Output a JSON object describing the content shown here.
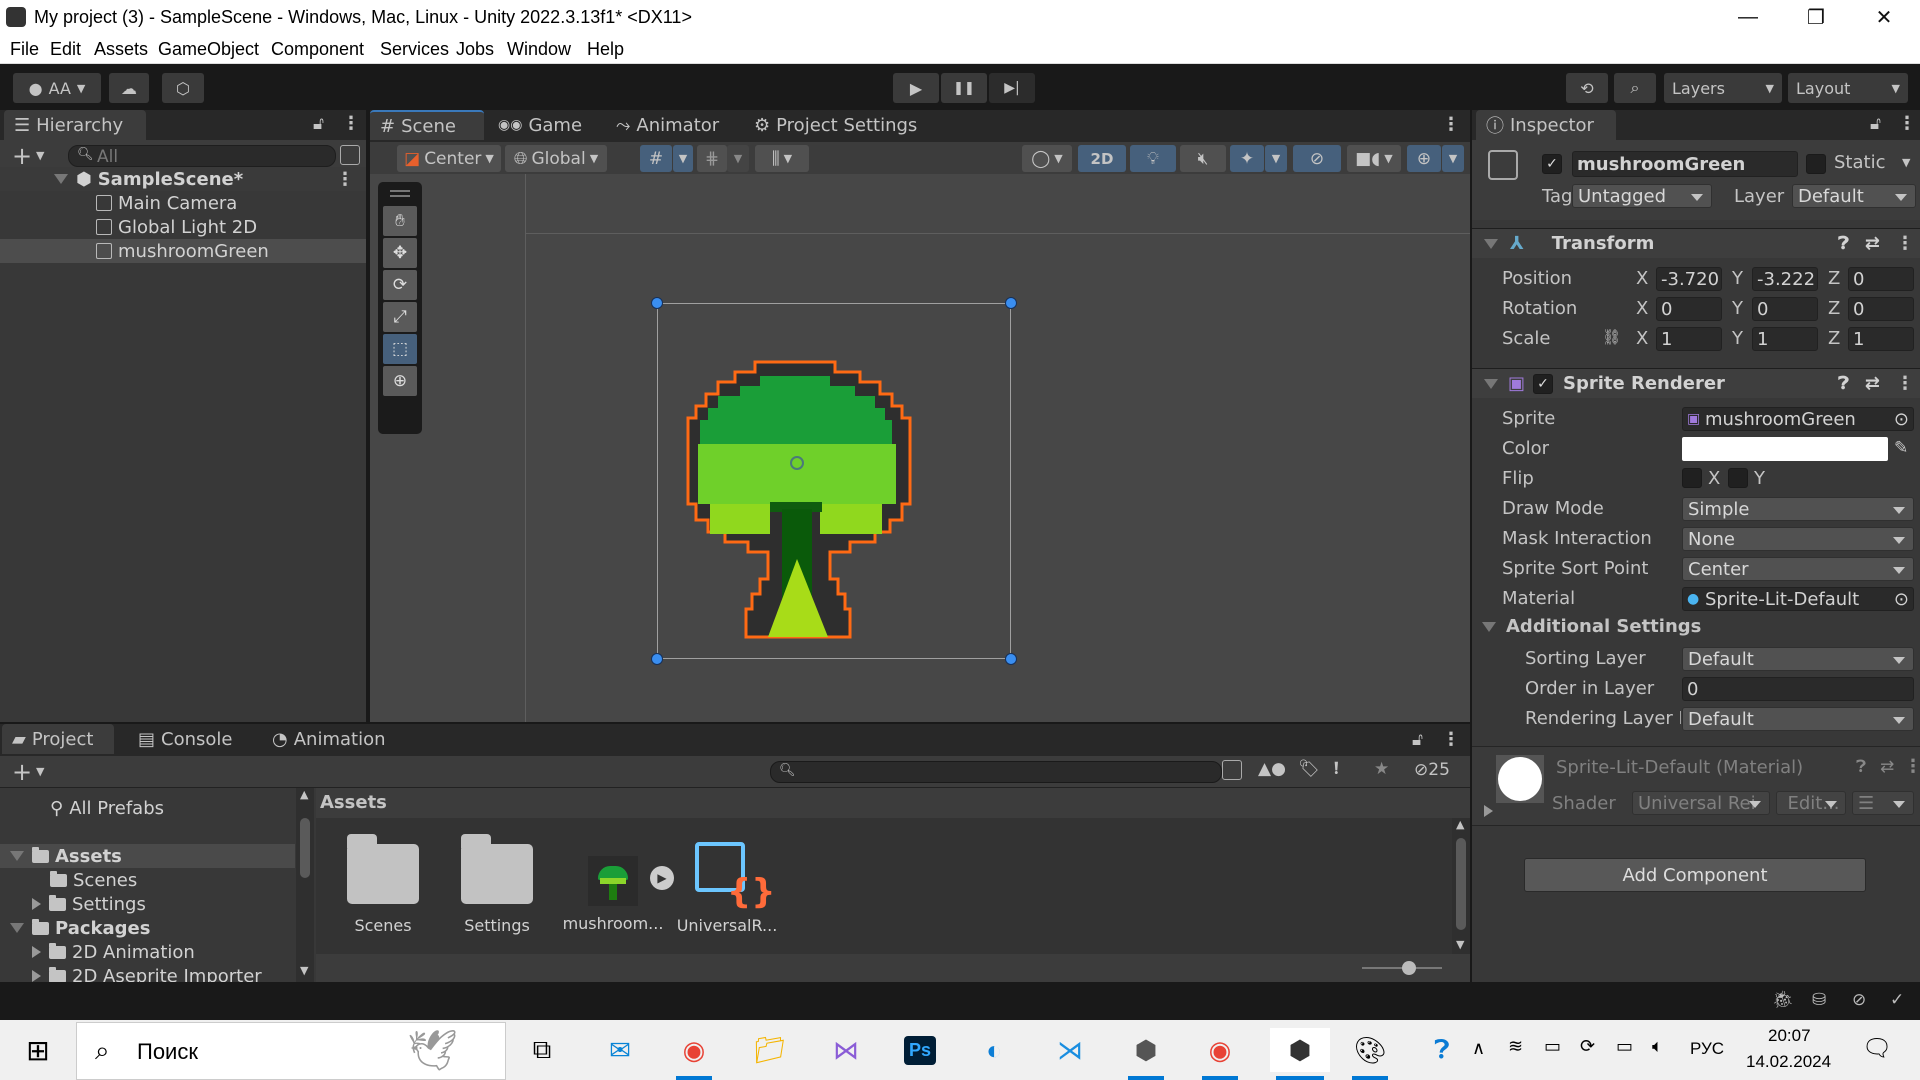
{
  "window": {
    "title": "My project (3) - SampleScene - Windows, Mac, Linux - Unity 2022.3.13f1* <DX11>",
    "controls": {
      "minimize": "—",
      "maximize": "❐",
      "close": "✕"
    }
  },
  "menu": [
    "File",
    "Edit",
    "Assets",
    "GameObject",
    "Component",
    "Services",
    "Jobs",
    "Window",
    "Help"
  ],
  "toolbar": {
    "account_label": "AA",
    "play_icon": "▶",
    "pause_icon": "❚❚",
    "step_icon": "▶|",
    "history_icon": "⟲",
    "search_icon": "⌕",
    "layers_label": "Layers",
    "layout_label": "Layout"
  },
  "hierarchy": {
    "tab_label": "Hierarchy",
    "search_placeholder": "All",
    "add_label": "+",
    "scene_name": "SampleScene*",
    "items": [
      "Main Camera",
      "Global Light 2D",
      "mushroomGreen"
    ],
    "selected": "mushroomGreen"
  },
  "center_tabs": [
    {
      "label": "Scene",
      "icon": "#"
    },
    {
      "label": "Game",
      "icon": "🎮"
    },
    {
      "label": "Animator",
      "icon": "⤳"
    },
    {
      "label": "Project Settings",
      "icon": "⚙"
    }
  ],
  "scene_toolbar": {
    "pivot_label": "Center",
    "space_label": "Global",
    "mode_2d_label": "2D"
  },
  "scene_tools": [
    "hand",
    "move",
    "rotate",
    "scale",
    "rect",
    "transform"
  ],
  "scene_tools_selected": "rect",
  "inspector": {
    "tab_label": "Inspector",
    "object_name": "mushroomGreen",
    "active": true,
    "static_label": "Static",
    "static": false,
    "tag_label": "Tag",
    "tag_value": "Untagged",
    "layer_label": "Layer",
    "layer_value": "Default",
    "transform": {
      "title": "Transform",
      "position_label": "Position",
      "rotation_label": "Rotation",
      "scale_label": "Scale",
      "position": {
        "x": "-3.720",
        "y": "-3.222",
        "z": "0"
      },
      "rotation": {
        "x": "0",
        "y": "0",
        "z": "0"
      },
      "scale": {
        "x": "1",
        "y": "1",
        "z": "1"
      }
    },
    "sprite_renderer": {
      "title": "Sprite Renderer",
      "enabled": true,
      "sprite_label": "Sprite",
      "sprite_value": "mushroomGreen",
      "color_label": "Color",
      "color_value": "#FFFFFF",
      "flip_label": "Flip",
      "flip_x_label": "X",
      "flip_y_label": "Y",
      "draw_mode_label": "Draw Mode",
      "draw_mode_value": "Simple",
      "mask_label": "Mask Interaction",
      "mask_value": "None",
      "sort_point_label": "Sprite Sort Point",
      "sort_point_value": "Center",
      "material_label": "Material",
      "material_value": "Sprite-Lit-Default",
      "additional_label": "Additional Settings",
      "sorting_layer_label": "Sorting Layer",
      "sorting_layer_value": "Default",
      "order_label": "Order in Layer",
      "order_value": "0",
      "rendering_layer_label": "Rendering Layer M",
      "rendering_layer_value": "Default"
    },
    "material": {
      "title": "Sprite-Lit-Default (Material)",
      "shader_label": "Shader",
      "shader_value": "Universal Rei",
      "edit_label": "Edit..."
    },
    "add_component_label": "Add Component"
  },
  "bottom_tabs": [
    {
      "label": "Project",
      "icon": "▬"
    },
    {
      "label": "Console",
      "icon": "▤"
    },
    {
      "label": "Animation",
      "icon": "◔"
    }
  ],
  "project": {
    "add_label": "+",
    "hidden_count": "25",
    "tree": [
      {
        "label": "All Prefabs",
        "kind": "search"
      },
      {
        "label": "Assets",
        "kind": "root",
        "expanded": true,
        "selected": true
      },
      {
        "label": "Scenes",
        "kind": "child"
      },
      {
        "label": "Settings",
        "kind": "child-collapsed"
      },
      {
        "label": "Packages",
        "kind": "root",
        "expanded": true
      },
      {
        "label": "2D Animation",
        "kind": "child-collapsed"
      },
      {
        "label": "2D Aseprite Importer",
        "kind": "child-collapsed"
      }
    ],
    "breadcrumb": "Assets",
    "assets": [
      {
        "label": "Scenes",
        "type": "folder"
      },
      {
        "label": "Settings",
        "type": "folder"
      },
      {
        "label": "mushroom...",
        "type": "sprite"
      },
      {
        "label": "UniversalR...",
        "type": "asset"
      }
    ]
  },
  "taskbar": {
    "search_placeholder": "Поиск",
    "language": "РУС",
    "time": "20:07",
    "date": "14.02.2024"
  }
}
